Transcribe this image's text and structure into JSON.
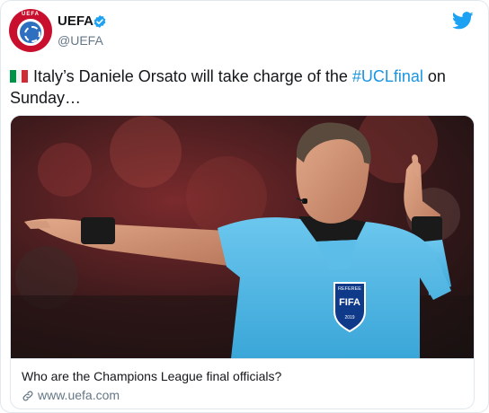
{
  "account": {
    "name": "UEFA",
    "handle": "@UEFA",
    "avatar_text": "UEFA",
    "icons": {
      "verified": "verified-badge-icon",
      "platform": "twitter-bird-icon"
    }
  },
  "tweet": {
    "flag": "italy-flag-icon",
    "text_before": "Italy’s Daniele Orsato will take charge of the ",
    "hashtag": "#UCLfinal",
    "text_after": " on Sunday…"
  },
  "card": {
    "image_badge_top": "REFEREE",
    "image_badge_main": "FIFA",
    "image_badge_year": "2019",
    "title": "Who are the Champions League final officials?",
    "link": "www.uefa.com",
    "link_icon": "link-icon"
  },
  "colors": {
    "accent": "#1b95e0",
    "verified": "#1da1f2",
    "brand_red": "#c8102e",
    "shirt": "#4fb6e3",
    "secondary_text": "#657786"
  }
}
